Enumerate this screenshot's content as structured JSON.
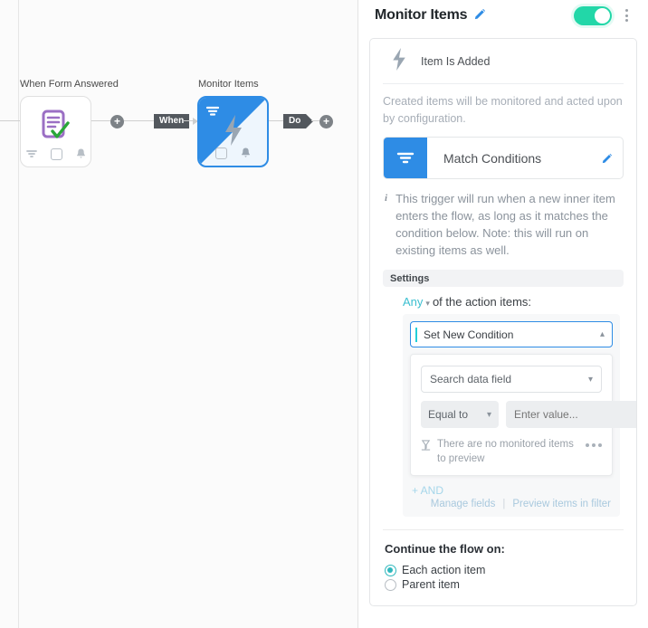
{
  "canvas": {
    "nodes": [
      {
        "label": "When Form Answered",
        "icons": [
          "filter-icon",
          "checkbox-icon",
          "bell-icon"
        ],
        "selected": false
      },
      {
        "label": "Monitor Items",
        "icons": [
          "checkbox-icon",
          "bell-icon"
        ],
        "selected": true
      }
    ],
    "tags": {
      "when": "When",
      "do": "Do"
    },
    "add_button_label": "+"
  },
  "panel": {
    "title": "Monitor Items",
    "edit_icon": "pencil-icon",
    "toggle_on": true,
    "toggle_color": "#22d7a8",
    "menu_icon": "kebab-menu-icon",
    "trigger": {
      "icon": "lightning-bolt-icon",
      "name": "Item Is Added",
      "description": "Created items will be monitored and acted upon by configuration."
    },
    "match_conditions": {
      "icon": "filter-icon",
      "label": "Match Conditions",
      "edit_icon": "pencil-icon",
      "accent_color": "#2e8ce5"
    },
    "info": {
      "icon": "info-icon",
      "text": "This trigger will run when a new inner item enters the flow, as long as it matches the condition below. Note: this will run on existing items as well."
    },
    "settings_label": "Settings",
    "any_clause": {
      "any_label": "Any",
      "chevron": "chevron-down-icon",
      "suffix": "of the action items:"
    },
    "condition": {
      "selected_value": "Set New Condition",
      "chevron": "chevron-up-icon",
      "field_placeholder": "Search data field",
      "field_chevron": "chevron-down-icon",
      "operator": "Equal to",
      "operator_chevron": "chevron-down-icon",
      "value_placeholder": "Enter value...",
      "preview_icon": "no-preview-icon",
      "preview_text": "There are no monitored items to preview",
      "more_icon": "ellipsis-icon",
      "add_and": "+ AND",
      "manage_fields": "Manage fields",
      "separator": "|",
      "preview_items": "Preview items in filter"
    },
    "continue": {
      "title": "Continue the flow on:",
      "options": [
        {
          "label": "Each action item",
          "selected": true
        },
        {
          "label": "Parent item",
          "selected": false
        }
      ]
    }
  }
}
